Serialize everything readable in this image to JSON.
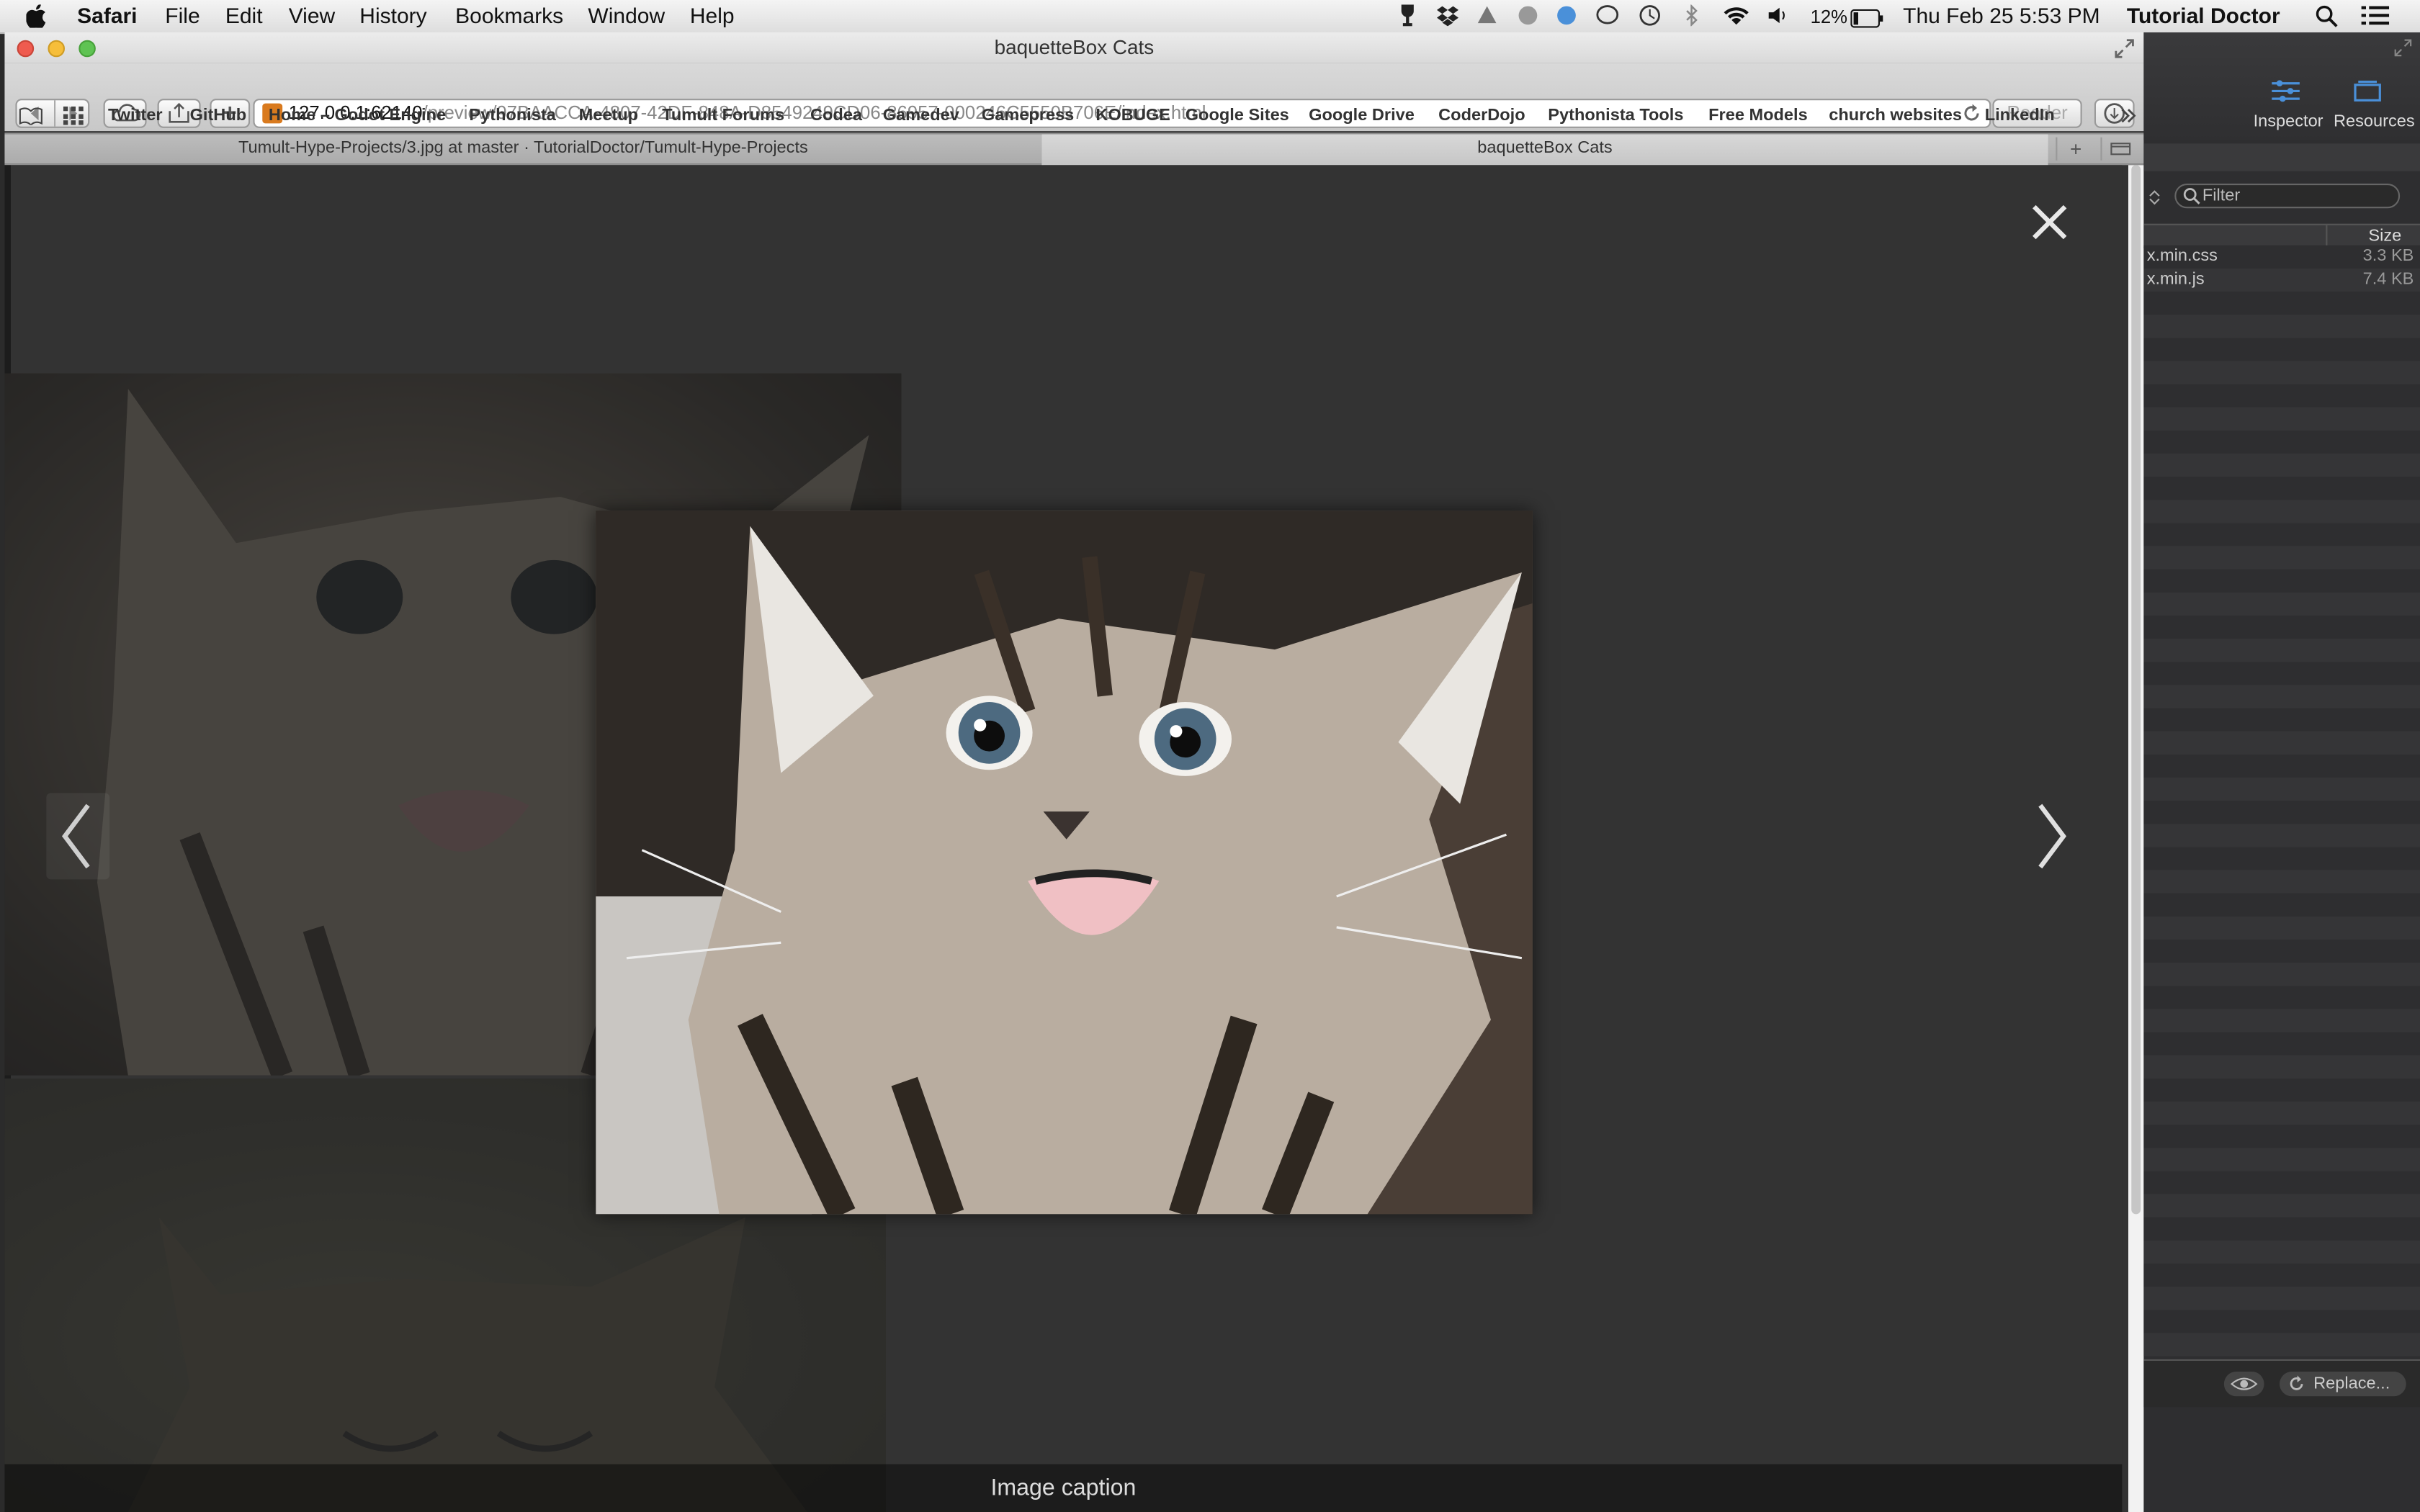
{
  "menubar": {
    "app": "Safari",
    "items": [
      "File",
      "Edit",
      "View",
      "History",
      "Bookmarks",
      "Window",
      "Help"
    ],
    "battery": "12%",
    "datetime": "Thu Feb 25  5:53 PM",
    "user": "Tutorial Doctor"
  },
  "window": {
    "title": "baquetteBox Cats"
  },
  "toolbar": {
    "url_host": "127.0.0.1:62140",
    "url_path": "/preview/97BAACCA-4807-42DF-848A-D8549249CD06-86957-000246C5550B706E/index.html",
    "reader_label": "Reader",
    "add_label": "+"
  },
  "bookmarks": [
    "Twitter",
    "GitHub",
    "Home – Godot Engine",
    "Pythonista",
    "Meetup",
    "Tumult Forums",
    "Codea",
    "Gamedev",
    "Gamepress",
    "KOBUGE",
    "Google Sites",
    "Google Drive",
    "CoderDojo",
    "Pythonista Tools",
    "Free Models",
    "church websites",
    "LinkedIn"
  ],
  "tabs": [
    {
      "label": "Tumult-Hype-Projects/3.jpg at master · TutorialDoctor/Tumult-Hype-Projects"
    },
    {
      "label": "baquetteBox Cats"
    }
  ],
  "lightbox": {
    "caption": "Image caption"
  },
  "panel": {
    "inspector_label": "Inspector",
    "resources_label": "Resources",
    "filter_placeholder": "Filter",
    "size_header": "Size",
    "files": [
      {
        "name": "x.min.css",
        "size": "3.3 KB"
      },
      {
        "name": "x.min.js",
        "size": "7.4 KB"
      }
    ],
    "replace_label": "Replace..."
  }
}
